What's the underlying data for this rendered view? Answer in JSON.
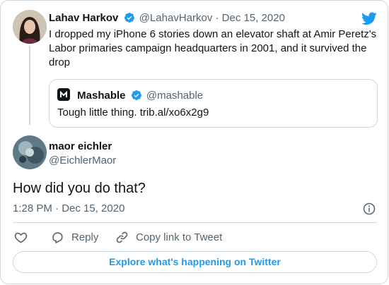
{
  "original": {
    "author_name": "Lahav Harkov",
    "author_handle": "@LahavHarkov",
    "date": "· Dec 15, 2020",
    "text": "I dropped my iPhone 6 stories down an elevator shaft at Amir Peretz's Labor primaries campaign headquarters in 2001, and it survived the drop"
  },
  "quoted": {
    "author_name": "Mashable",
    "author_handle": "@mashable",
    "text": "Tough little thing. trib.al/xo6x2g9"
  },
  "reply": {
    "author_name": "maor eichler",
    "author_handle": "@EichlerMaor",
    "text": "How did you do that?",
    "timestamp": "1:28 PM · Dec 15, 2020"
  },
  "actions": {
    "reply_label": "Reply",
    "copy_link_label": "Copy link to Tweet"
  },
  "explore_label": "Explore what's happening on Twitter",
  "colors": {
    "accent": "#1d9bf0",
    "text": "#0f1419",
    "muted": "#536471",
    "border": "#cfd9de"
  },
  "icons": [
    "twitter-bird-icon",
    "verified-badge-icon",
    "info-icon",
    "heart-icon",
    "reply-icon",
    "link-icon"
  ]
}
